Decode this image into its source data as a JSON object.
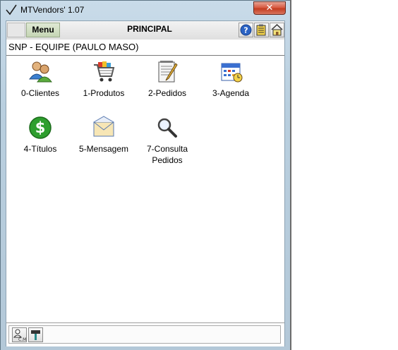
{
  "window": {
    "title": "MTVendors' 1.07",
    "close_label": "✕"
  },
  "toolbar": {
    "menu_label": "Menu",
    "title": "PRINCIPAL",
    "icons": [
      "help-icon",
      "notes-icon",
      "home-icon"
    ]
  },
  "team": {
    "label": "SNP - EQUIPE (PAULO MASO)"
  },
  "modules": [
    {
      "label": "0-Clientes",
      "icon": "clients-icon"
    },
    {
      "label": "1-Produtos",
      "icon": "shopping-cart-icon"
    },
    {
      "label": "2-Pedidos",
      "icon": "notepad-icon"
    },
    {
      "label": "3-Agenda",
      "icon": "calendar-icon"
    },
    {
      "label": "4-Títulos",
      "icon": "dollar-icon"
    },
    {
      "label": "5-Mensagem",
      "icon": "envelope-icon"
    },
    {
      "label": "7-Consulta\nPedidos",
      "icon": "magnifier-icon"
    }
  ],
  "bottom_icons": [
    "user-config-icon",
    "tools-icon"
  ],
  "colors": {
    "close": "#c94a30",
    "menu": "#c5d5b4",
    "dollar": "#2e9e2e"
  }
}
